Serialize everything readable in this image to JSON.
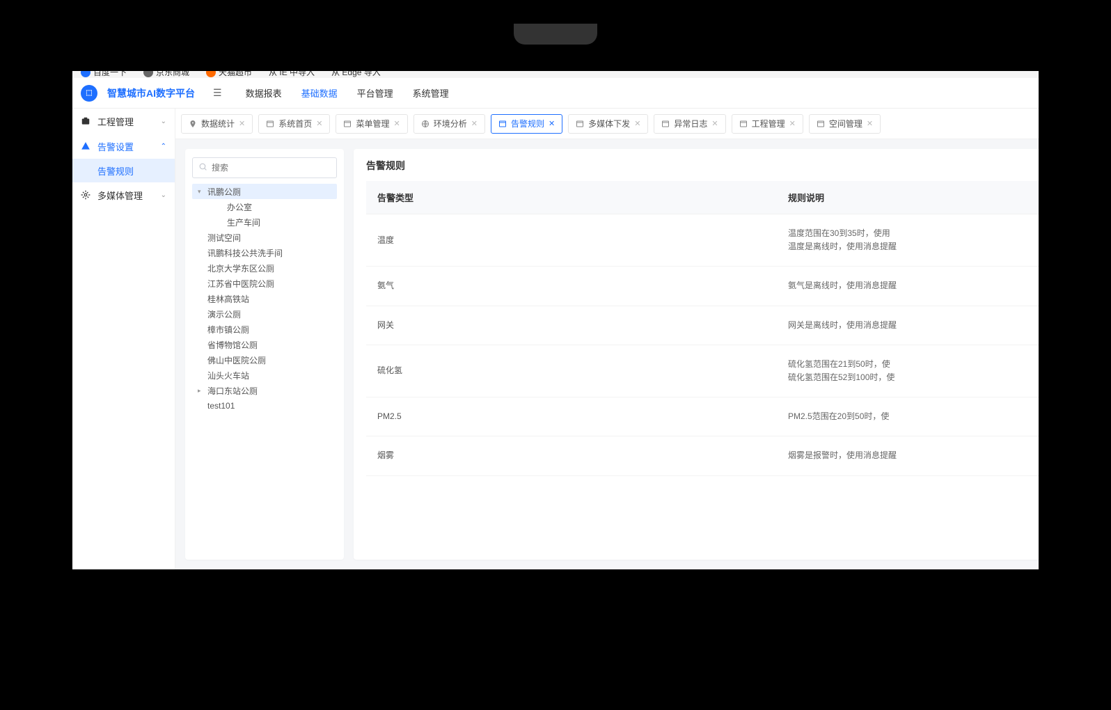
{
  "bookmarks": [
    {
      "label": "百度一下"
    },
    {
      "label": "京东商城"
    },
    {
      "label": "天猫超市"
    },
    {
      "label": "从 IE 中导入"
    },
    {
      "label": "从 Edge 导入"
    }
  ],
  "header": {
    "app_title": "智慧城市AI数字平台",
    "nav": [
      {
        "label": "数据报表",
        "active": false
      },
      {
        "label": "基础数据",
        "active": true
      },
      {
        "label": "平台管理",
        "active": false
      },
      {
        "label": "系统管理",
        "active": false
      }
    ]
  },
  "sidebar": {
    "groups": [
      {
        "icon": "project-icon",
        "label": "工程管理",
        "expanded": false
      },
      {
        "icon": "alert-icon",
        "label": "告警设置",
        "active": true,
        "expanded": true,
        "subs": [
          {
            "label": "告警规则",
            "selected": true
          }
        ]
      },
      {
        "icon": "media-icon",
        "label": "多媒体管理",
        "expanded": false
      }
    ]
  },
  "tabs": [
    {
      "icon": "pin",
      "label": "数据统计"
    },
    {
      "icon": "window",
      "label": "系统首页"
    },
    {
      "icon": "window",
      "label": "菜单管理"
    },
    {
      "icon": "env",
      "label": "环境分析"
    },
    {
      "icon": "window",
      "label": "告警规则",
      "active": true
    },
    {
      "icon": "window",
      "label": "多媒体下发"
    },
    {
      "icon": "window",
      "label": "异常日志"
    },
    {
      "icon": "window",
      "label": "工程管理"
    },
    {
      "icon": "window",
      "label": "空间管理"
    }
  ],
  "tree": {
    "search_placeholder": "搜索",
    "nodes": [
      {
        "label": "讯鹏公厕",
        "depth": 0,
        "selected": true,
        "toggle": "▾"
      },
      {
        "label": "办公室",
        "depth": 1,
        "child": true
      },
      {
        "label": "生产车间",
        "depth": 1,
        "child": true
      },
      {
        "label": "测试空间",
        "depth": 0
      },
      {
        "label": "讯鹏科技公共洗手间",
        "depth": 0
      },
      {
        "label": "北京大学东区公厕",
        "depth": 0
      },
      {
        "label": "江苏省中医院公厕",
        "depth": 0
      },
      {
        "label": "桂林高铁站",
        "depth": 0
      },
      {
        "label": "演示公厕",
        "depth": 0
      },
      {
        "label": "樟市镇公厕",
        "depth": 0
      },
      {
        "label": "省博物馆公厕",
        "depth": 0
      },
      {
        "label": "佛山中医院公厕",
        "depth": 0
      },
      {
        "label": "汕头火车站",
        "depth": 0
      },
      {
        "label": "海口东站公厕",
        "depth": 0,
        "toggle": "▸"
      },
      {
        "label": "test101",
        "depth": 0
      }
    ]
  },
  "table": {
    "title": "告警规则",
    "headers": {
      "type": "告警类型",
      "desc": "规则说明"
    },
    "rows": [
      {
        "type": "温度",
        "desc": "温度范围在30到35时，使用\n温度是离线时，使用消息提醒"
      },
      {
        "type": "氨气",
        "desc": "氨气是离线时，使用消息提醒"
      },
      {
        "type": "网关",
        "desc": "网关是离线时，使用消息提醒"
      },
      {
        "type": "硫化氢",
        "desc": "硫化氢范围在21到50时，使\n硫化氢范围在52到100时，使"
      },
      {
        "type": "PM2.5",
        "desc": "PM2.5范围在20到50时，使"
      },
      {
        "type": "烟雾",
        "desc": "烟雾是报警时，使用消息提醒"
      }
    ]
  }
}
